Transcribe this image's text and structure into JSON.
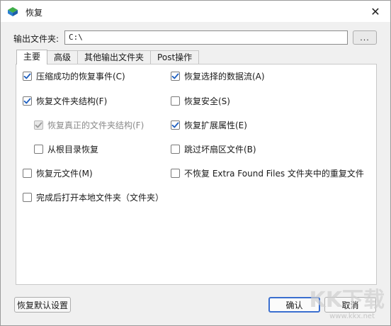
{
  "window": {
    "title": "恢复",
    "close_glyph": "✕"
  },
  "output": {
    "label": "输出文件夹:",
    "value": "C:\\",
    "browse_label": "..."
  },
  "tabs": [
    {
      "label": "主要",
      "active": true
    },
    {
      "label": "高级",
      "active": false
    },
    {
      "label": "其他输出文件夹",
      "active": false
    },
    {
      "label": "Post操作",
      "active": false
    }
  ],
  "options": {
    "compress_success": {
      "label": "压缩成功的恢复事件(C)",
      "checked": true,
      "disabled": false
    },
    "restore_folder_structure": {
      "label": "恢复文件夹结构(F)",
      "checked": true,
      "disabled": false
    },
    "restore_real_structure": {
      "label": "恢复真正的文件夹结构(F)",
      "checked": true,
      "disabled": true
    },
    "restore_from_root": {
      "label": "从根目录恢复",
      "checked": false,
      "disabled": false
    },
    "restore_metafiles": {
      "label": "恢复元文件(M)",
      "checked": false,
      "disabled": false
    },
    "open_local_folder": {
      "label": "完成后打开本地文件夹（文件夹）",
      "checked": false,
      "disabled": false
    },
    "restore_selected_streams": {
      "label": "恢复选择的数据流(A)",
      "checked": true,
      "disabled": false
    },
    "restore_security": {
      "label": "恢复安全(S)",
      "checked": false,
      "disabled": false
    },
    "restore_extended_attrs": {
      "label": "恢复扩展属性(E)",
      "checked": true,
      "disabled": false
    },
    "skip_bad_sectors": {
      "label": "跳过坏扇区文件(B)",
      "checked": false,
      "disabled": false
    },
    "no_restore_duplicates": {
      "label": "不恢复 Extra Found Files 文件夹中的重复文件",
      "checked": false,
      "disabled": false
    }
  },
  "buttons": {
    "restore_defaults": "恢复默认设置",
    "ok": "确认",
    "cancel": "取消"
  },
  "watermark": {
    "text": "KK下载",
    "url": "www.kkx.net"
  },
  "colors": {
    "accent": "#3b6fcf",
    "check": "#1f5fbf"
  }
}
